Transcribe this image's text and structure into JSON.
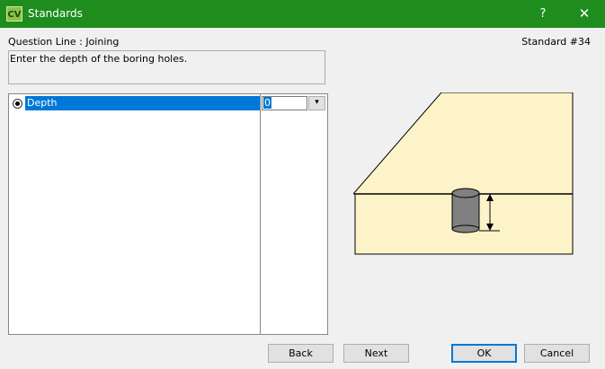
{
  "window": {
    "app_icon": "CV",
    "title": "Standards",
    "help_label": "?",
    "close_label": "✕"
  },
  "header": {
    "question_line": "Question Line : Joining",
    "standard_number": "Standard #34"
  },
  "description": "Enter the depth of the boring holes.",
  "list": {
    "rows": [
      {
        "label": "Depth",
        "value": "0",
        "selected": true
      }
    ],
    "dropdown_icon": "chevron-down-icon"
  },
  "buttons": {
    "back": "Back",
    "next": "Next",
    "ok": "OK",
    "cancel": "Cancel"
  },
  "colors": {
    "titlebar": "#1e8d1e",
    "selection": "#0078d7",
    "wood": "#fdf3c9",
    "hole": "#808080"
  }
}
